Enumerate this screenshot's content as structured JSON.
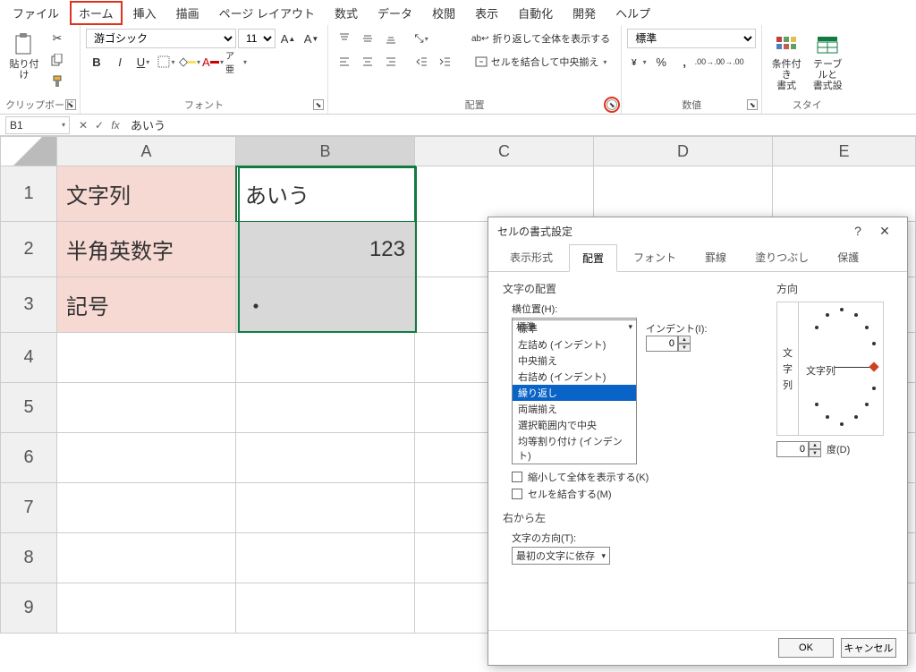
{
  "menu": {
    "items": [
      "ファイル",
      "ホーム",
      "挿入",
      "描画",
      "ページ レイアウト",
      "数式",
      "データ",
      "校閲",
      "表示",
      "自動化",
      "開発",
      "ヘルプ"
    ],
    "highlighted_index": 1
  },
  "ribbon": {
    "clipboard": {
      "paste": "貼り付け",
      "label": "クリップボード"
    },
    "font": {
      "name": "游ゴシック",
      "size": "11",
      "label": "フォント"
    },
    "alignment": {
      "wrap": "折り返して全体を表示する",
      "merge": "セルを結合して中央揃え",
      "label": "配置"
    },
    "number": {
      "format": "標準",
      "label": "数値"
    },
    "styles": {
      "cond": "条件付き\n書式",
      "table": "テーブルと\n書式設",
      "label": "スタイ"
    }
  },
  "formula_bar": {
    "name_box": "B1",
    "formula": "あいう"
  },
  "grid": {
    "columns": [
      "A",
      "B",
      "C",
      "D",
      "E"
    ],
    "rows": [
      {
        "n": "1",
        "a": "文字列",
        "b": "あいう"
      },
      {
        "n": "2",
        "a": "半角英数字",
        "b": "123"
      },
      {
        "n": "3",
        "a": "記号",
        "b": "・"
      },
      {
        "n": "4"
      },
      {
        "n": "5"
      },
      {
        "n": "6"
      },
      {
        "n": "7"
      },
      {
        "n": "8"
      },
      {
        "n": "9"
      }
    ]
  },
  "dialog": {
    "title": "セルの書式設定",
    "tabs": [
      "表示形式",
      "配置",
      "フォント",
      "罫線",
      "塗りつぶし",
      "保護"
    ],
    "active_tab": 1,
    "text_align_section": "文字の配置",
    "h_label": "横位置(H):",
    "h_value": "標準",
    "h_options": [
      "標準",
      "左詰め (インデント)",
      "中央揃え",
      "右詰め (インデント)",
      "繰り返し",
      "両端揃え",
      "選択範囲内で中央",
      "均等割り付け (インデント)"
    ],
    "h_highlight_index": 4,
    "indent_label": "インデント(I):",
    "indent_value": "0",
    "v_label": "文",
    "shrink": "縮小して全体を表示する(K)",
    "merge": "セルを結合する(M)",
    "rtl_section": "右から左",
    "dir_label": "文字の方向(T):",
    "dir_value": "最初の文字に依存",
    "orient_section": "方向",
    "orient_vertical": [
      "文",
      "字",
      "列"
    ],
    "orient_text": "文字列",
    "degree_value": "0",
    "degree_label": "度(D)",
    "ok": "OK",
    "cancel": "キャンセル"
  }
}
